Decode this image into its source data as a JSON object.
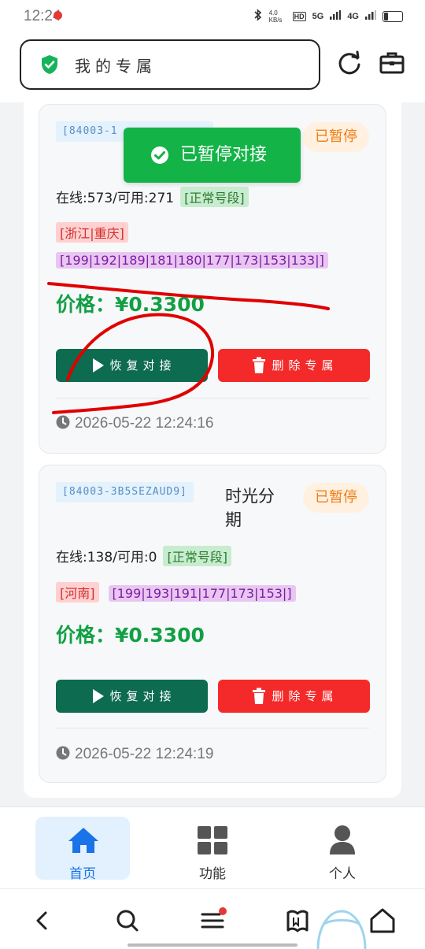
{
  "status_bar": {
    "time": "12:24",
    "network_speed": "4.0 KB/s",
    "network_1": "5G",
    "network_2": "4G",
    "battery": "21"
  },
  "header": {
    "title": "我的专属",
    "shield_icon": "shield-check-icon",
    "refresh_icon": "refresh-icon",
    "toolbox_icon": "toolbox-icon"
  },
  "toast": {
    "text": "已暂停对接"
  },
  "cards": [
    {
      "code": "[84003-1",
      "name": "",
      "status": "已暂停",
      "online": "在线:573/可用:271",
      "segment_tag": "[正常号段]",
      "region_tag": "[浙江|重庆]",
      "prefix_tag": "[199|192|189|181|180|177|173|153|133|]",
      "price": "价格：¥0.3300",
      "resume_label": "恢复对接",
      "delete_label": "删除专属",
      "time": "2026-05-22 12:24:16"
    },
    {
      "code": "[84003-3B5SEZAUD9]",
      "name": "时光分期",
      "status": "已暂停",
      "online": "在线:138/可用:0",
      "segment_tag": "[正常号段]",
      "region_tag": "[河南]",
      "prefix_tag": "[199|193|191|177|173|153|]",
      "price": "价格：¥0.3300",
      "resume_label": "恢复对接",
      "delete_label": "删除专属",
      "time": "2026-05-22 12:24:19"
    }
  ],
  "tabs": [
    {
      "label": "首页",
      "icon": "home-icon",
      "active": true
    },
    {
      "label": "功能",
      "icon": "grid-icon",
      "active": false
    },
    {
      "label": "个人",
      "icon": "person-icon",
      "active": false
    }
  ],
  "colors": {
    "primary_green": "#12a045",
    "resume_button": "#0d6b4f",
    "delete_button": "#f42a2a",
    "paused_badge": "#ef7d13",
    "toast": "#13b347",
    "active_tab": "#1a73e8",
    "scribble": "#e00000"
  }
}
